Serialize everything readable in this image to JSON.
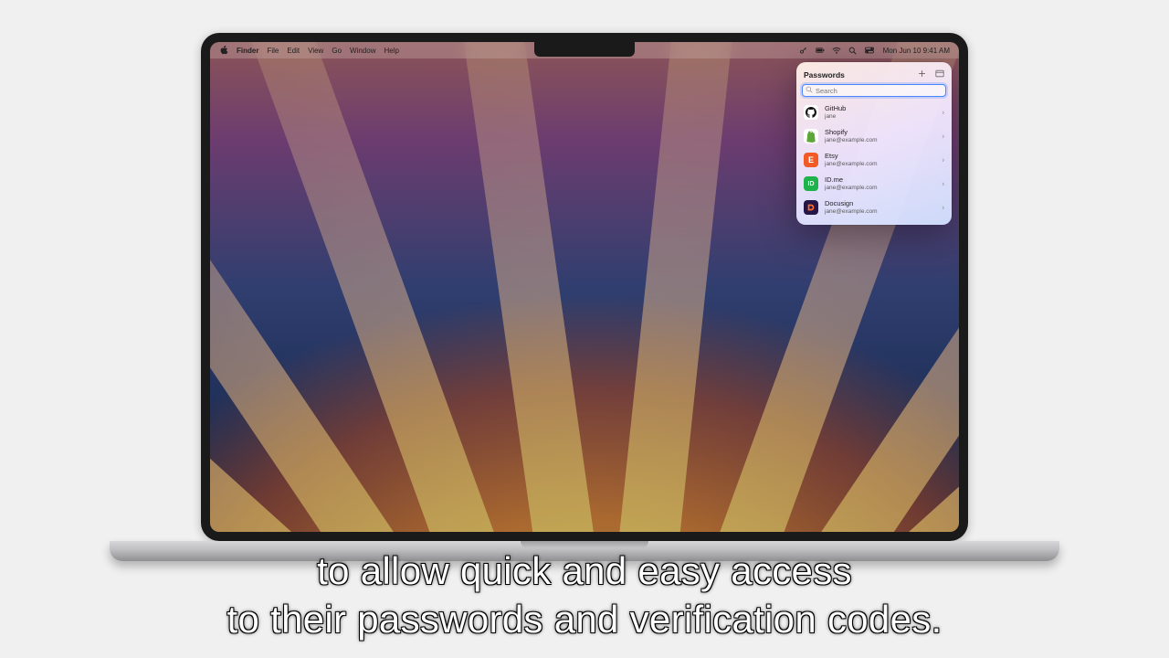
{
  "menubar": {
    "app": "Finder",
    "items": [
      "File",
      "Edit",
      "View",
      "Go",
      "Window",
      "Help"
    ],
    "datetime": "Mon Jun 10  9:41 AM"
  },
  "popover": {
    "title": "Passwords",
    "search_placeholder": "Search",
    "entries": [
      {
        "name": "GitHub",
        "user": "jane",
        "bg": "#ffffff",
        "fg": "#111",
        "glyph": "gh"
      },
      {
        "name": "Shopify",
        "user": "jane@example.com",
        "bg": "#ffffff",
        "fg": "#5ca63a",
        "glyph": "sh"
      },
      {
        "name": "Etsy",
        "user": "jane@example.com",
        "bg": "#f15a24",
        "fg": "#fff",
        "glyph": "E"
      },
      {
        "name": "ID.me",
        "user": "jane@example.com",
        "bg": "#1db24a",
        "fg": "#fff",
        "glyph": "ID"
      },
      {
        "name": "Docusign",
        "user": "jane@example.com",
        "bg": "#241747",
        "fg": "#ff6a2b",
        "glyph": "ds"
      }
    ]
  },
  "caption": {
    "line1": "to allow quick and easy access",
    "line2": "to their passwords and verification codes."
  }
}
